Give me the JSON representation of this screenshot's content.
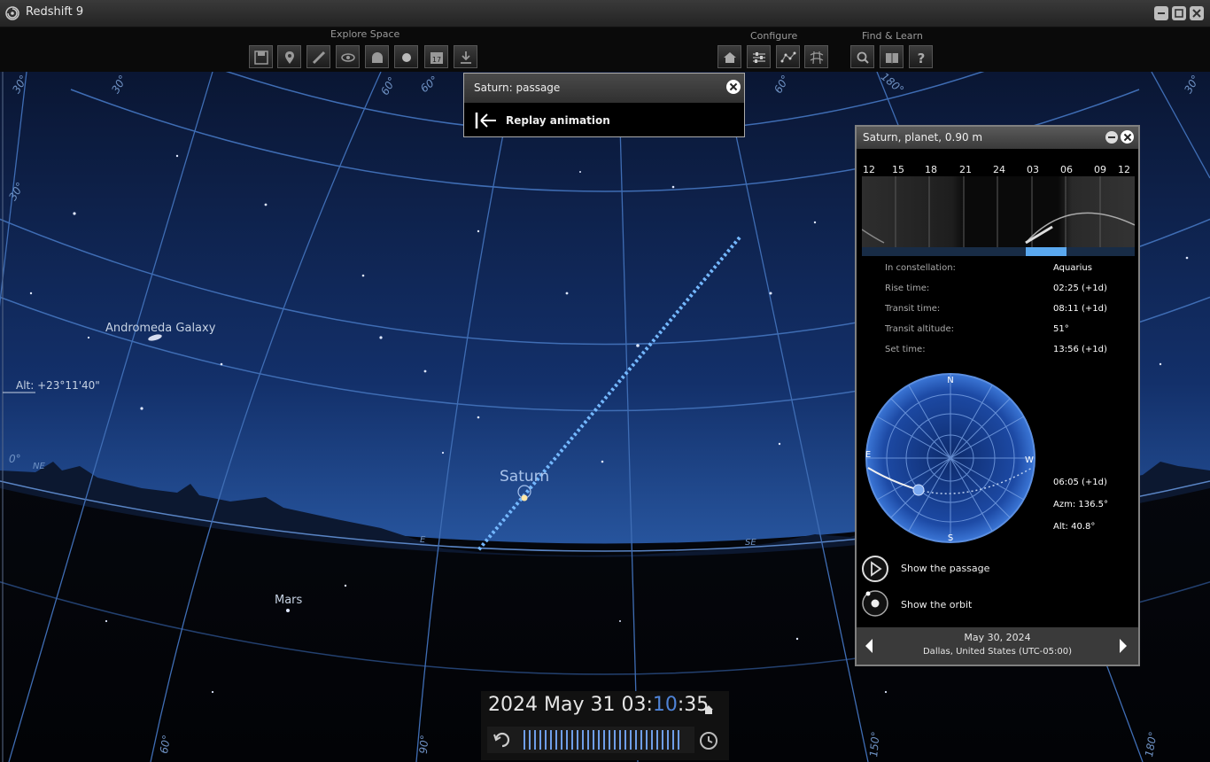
{
  "app": {
    "title": "Redshift 9"
  },
  "toolbar": {
    "groups": [
      {
        "label": "Explore Space"
      },
      {
        "label": "Configure"
      },
      {
        "label": "Find & Learn"
      }
    ]
  },
  "sky": {
    "objects": {
      "andromeda": "Andromeda Galaxy",
      "saturn": "Saturn",
      "mars": "Mars"
    },
    "altitude_readout": "Alt: +23°11'40\"",
    "horizon_labels": {
      "ne": "NE",
      "e": "E",
      "se": "SE"
    },
    "grid_labels": [
      "30°",
      "30°",
      "30°",
      "60°",
      "60°",
      "60°",
      "180°",
      "30°",
      "0°",
      "60°",
      "90°",
      "150°",
      "180°"
    ]
  },
  "popup": {
    "title": "Saturn: passage",
    "action_label": "Replay animation"
  },
  "info_panel": {
    "title": "Saturn, planet, 0.90 m",
    "hours": [
      "12",
      "15",
      "18",
      "21",
      "24",
      "03",
      "06",
      "09",
      "12"
    ],
    "rows": [
      {
        "label": "In constellation:",
        "value": "Aquarius"
      },
      {
        "label": "Rise time:",
        "value": "02:25 (+1d)"
      },
      {
        "label": "Transit time:",
        "value": "08:11 (+1d)"
      },
      {
        "label": "Transit altitude:",
        "value": "51°"
      },
      {
        "label": "Set time:",
        "value": "13:56 (+1d)"
      }
    ],
    "compass": {
      "n": "N",
      "e": "E",
      "s": "S",
      "w": "W"
    },
    "position": {
      "time": "06:05 (+1d)",
      "azm": "Azm: 136.5°",
      "alt": "Alt: 40.8°"
    },
    "show_passage_label": "Show the passage",
    "show_orbit_label": "Show the orbit",
    "date": "May 30, 2024",
    "location": "Dallas, United States (UTC-05:00)"
  },
  "clock": {
    "date_part": "2024 May 31 03:",
    "minutes": "10",
    "seconds_part": ":35"
  },
  "colors": {
    "sky_top": "#0b1a3f",
    "sky_horizon": "#2f5fa8",
    "grid": "#4d7cc0",
    "passage_line": "#6fb0ff",
    "accent": "#4f83d6"
  }
}
